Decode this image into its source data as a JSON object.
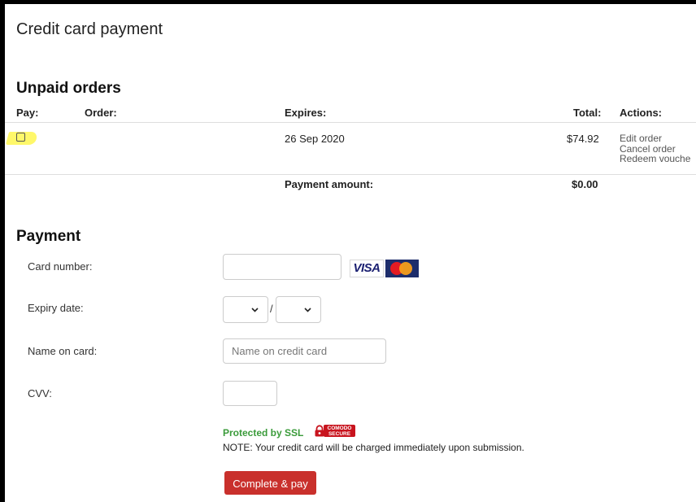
{
  "page": {
    "title": "Credit card payment"
  },
  "unpaid_orders": {
    "heading": "Unpaid orders",
    "columns": {
      "pay": "Pay:",
      "order": "Order:",
      "expires": "Expires:",
      "total": "Total:",
      "actions": "Actions:"
    },
    "rows": [
      {
        "checked": false,
        "order": "",
        "expires": "26 Sep 2020",
        "total": "$74.92",
        "actions": [
          "Edit order",
          "Cancel order",
          "Redeem vouche"
        ]
      }
    ],
    "payment_amount_label": "Payment amount:",
    "payment_amount_value": "$0.00"
  },
  "payment": {
    "heading": "Payment",
    "card_number_label": "Card number:",
    "card_number_value": "",
    "expiry_label": "Expiry date:",
    "expiry_month_value": "",
    "expiry_separator": "/",
    "expiry_year_value": "",
    "name_label": "Name on card:",
    "name_placeholder": "Name on credit card",
    "cvv_label": "CVV:",
    "cvv_value": "",
    "card_logos": [
      "visa-logo",
      "mastercard-logo"
    ],
    "visa_text": "VISA",
    "ssl_text": "Protected by SSL",
    "comodo_text": "COMODO SECURE",
    "note": "NOTE: Your credit card will be charged immediately upon submission.",
    "submit_label": "Complete & pay"
  },
  "colors": {
    "submit_button": "#c9302c",
    "ssl_text": "#3a9b3a",
    "highlight": "#fff86a"
  }
}
